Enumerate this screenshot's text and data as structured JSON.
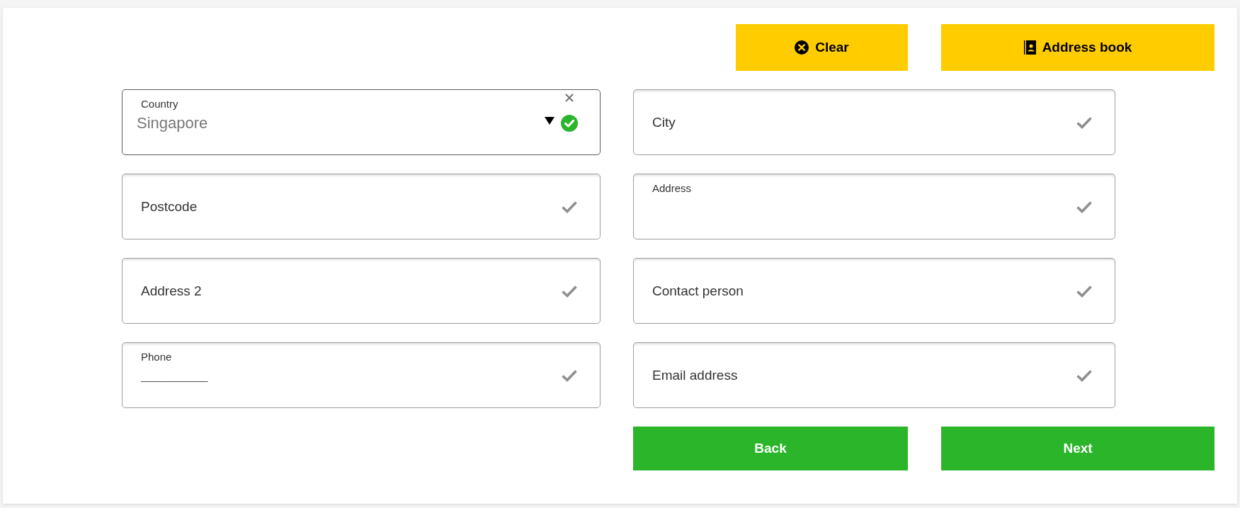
{
  "toolbar": [
    {
      "kind": "clear",
      "label": "Clear"
    },
    {
      "kind": "address_book",
      "label": "Address book"
    }
  ],
  "fields": [
    {
      "kind": "select",
      "label": "Country",
      "value": "Singapore",
      "focused": true,
      "valid": true
    },
    {
      "kind": "text",
      "placeholder": "Postcode",
      "focused": false,
      "valid": false
    },
    {
      "kind": "text",
      "placeholder": "Address 2",
      "focused": false,
      "valid": false
    },
    {
      "kind": "masked",
      "label": "Phone",
      "placeholder": "__________",
      "focused": false,
      "valid": false
    },
    {
      "kind": "text",
      "placeholder": "City",
      "focused": false,
      "valid": false
    },
    {
      "kind": "floating",
      "label": "Address",
      "focused": false,
      "valid": false
    },
    {
      "kind": "text",
      "placeholder": "Contact person",
      "focused": false,
      "valid": false
    },
    {
      "kind": "text",
      "placeholder": "Email address",
      "focused": false,
      "valid": false
    }
  ],
  "actions": [
    {
      "label": "Back"
    },
    {
      "label": "Next"
    }
  ]
}
